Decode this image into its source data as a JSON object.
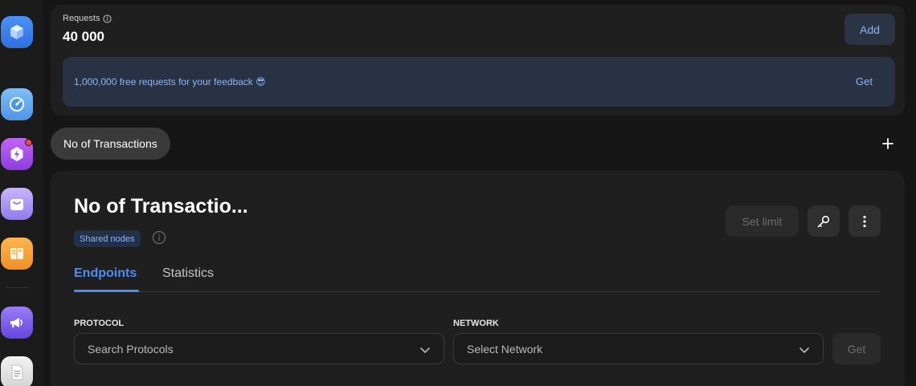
{
  "sidebar": {
    "apps": [
      {
        "icon": "cube-icon",
        "color": "#3d82f0"
      },
      {
        "icon": "speedometer-icon",
        "color": "#5aa6ee"
      },
      {
        "icon": "lightning-icon",
        "color": "#a14ee8"
      },
      {
        "icon": "bag-icon",
        "color": "#a78ef5"
      },
      {
        "icon": "book-icon",
        "color": "#f5a23b"
      },
      {
        "icon": "megaphone-icon",
        "color": "#7a5ae8"
      },
      {
        "icon": "document-icon",
        "color": "#e8e8e8"
      }
    ]
  },
  "requests": {
    "label": "Requests",
    "value": "40 000",
    "add_label": "Add"
  },
  "promo": {
    "text": "1,000,000 free requests for your feedback 😎",
    "get_label": "Get"
  },
  "project_pill": {
    "label": "No of Transactions"
  },
  "project": {
    "title": "No of Transactio...",
    "badge": "Shared nodes",
    "set_limit_label": "Set limit",
    "tabs": [
      {
        "label": "Endpoints",
        "active": true
      },
      {
        "label": "Statistics",
        "active": false
      }
    ],
    "protocol": {
      "label": "PROTOCOL",
      "placeholder": "Search Protocols"
    },
    "network": {
      "label": "NETWORK",
      "placeholder": "Select Network"
    },
    "get_label": "Get"
  },
  "colors": {
    "accent": "#4d8df5",
    "promo_bg": "#283244",
    "card_bg": "#1f1f1f"
  }
}
